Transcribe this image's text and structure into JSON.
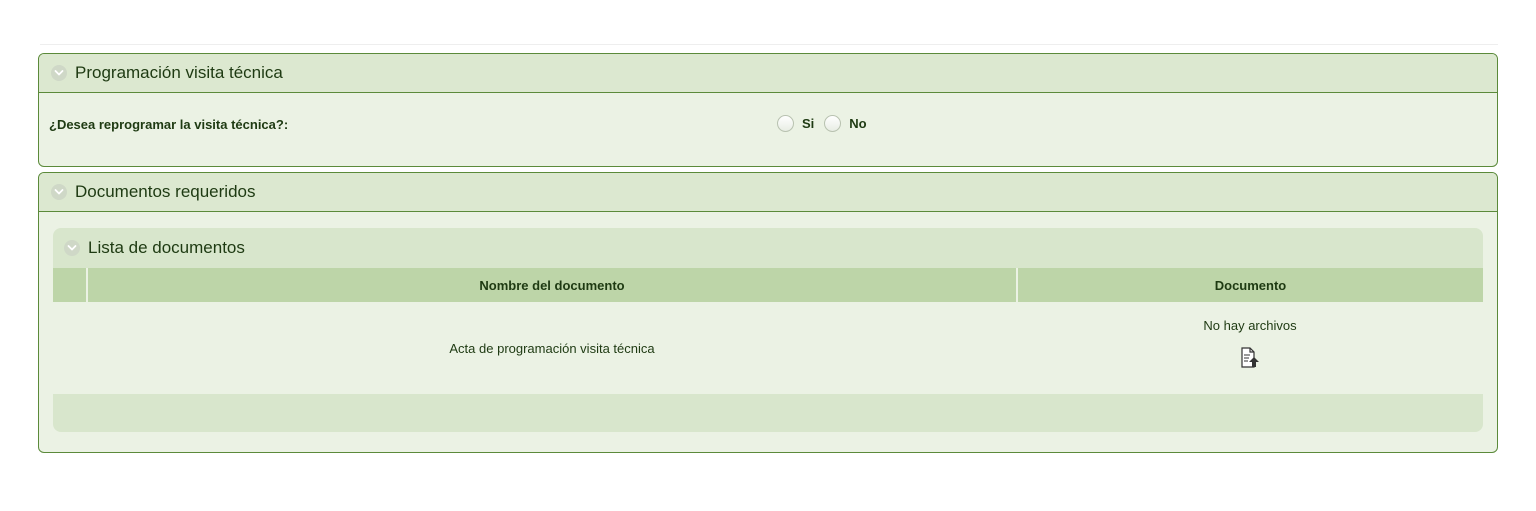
{
  "visita_panel": {
    "title": "Programación visita técnica",
    "question": "¿Desea reprogramar la visita técnica?:",
    "options": [
      "Si",
      "No"
    ]
  },
  "documentos_panel": {
    "title": "Documentos requeridos",
    "list": {
      "title": "Lista de documentos",
      "columns": [
        "Nombre del documento",
        "Documento"
      ],
      "rows": [
        {
          "name": "Acta de programación visita técnica",
          "status": "No hay archivos"
        }
      ]
    }
  },
  "icons": {
    "collapse": "chevron-down-icon",
    "upload": "file-upload-icon"
  },
  "colors": {
    "panel_border": "#5b8a3a",
    "panel_bg": "#ebf2e4",
    "table_header_bg": "#bdd5a8",
    "subpanel_bg": "#d8e6cc",
    "text": "#1e3a12"
  }
}
